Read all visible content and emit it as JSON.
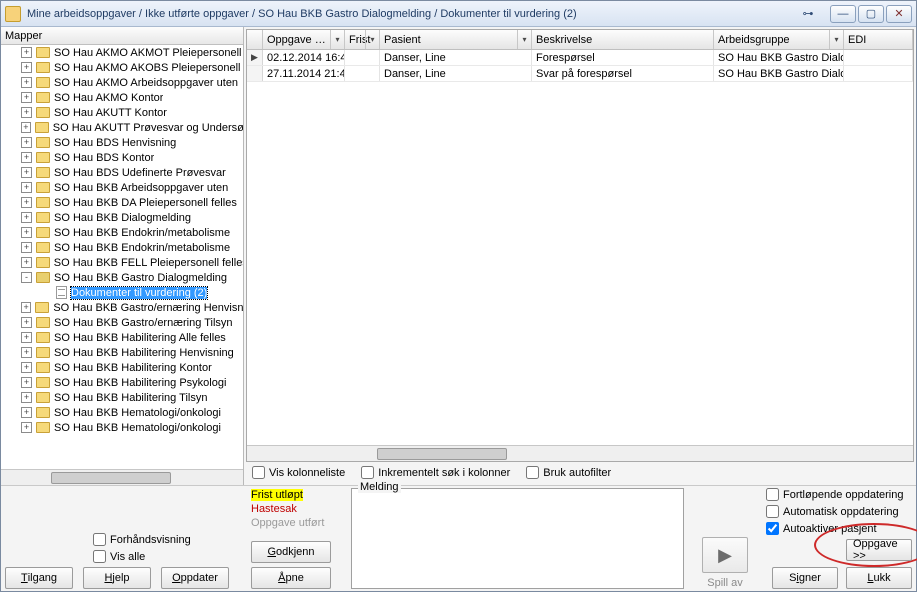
{
  "title": "Mine arbeidsoppgaver / Ikke utførte oppgaver / SO Hau BKB Gastro Dialogmelding / Dokumenter til vurdering (2)",
  "leftHeader": "Mapper",
  "tree": [
    {
      "l": "SO Hau AKMO AKMOT Pleiepersonell",
      "t": "+"
    },
    {
      "l": "SO Hau AKMO AKOBS Pleiepersonell",
      "t": "+"
    },
    {
      "l": "SO Hau AKMO Arbeidsoppgaver uten",
      "t": "+"
    },
    {
      "l": "SO Hau AKMO Kontor",
      "t": "+"
    },
    {
      "l": "SO Hau AKUTT Kontor",
      "t": "+"
    },
    {
      "l": "SO Hau AKUTT Prøvesvar og Undersøkelser",
      "t": "+"
    },
    {
      "l": "SO Hau BDS Henvisning",
      "t": "+"
    },
    {
      "l": "SO Hau BDS Kontor",
      "t": "+"
    },
    {
      "l": "SO Hau BDS Udefinerte Prøvesvar",
      "t": "+"
    },
    {
      "l": "SO Hau BKB Arbeidsoppgaver uten",
      "t": "+"
    },
    {
      "l": "SO Hau BKB DA Pleiepersonell felles",
      "t": "+"
    },
    {
      "l": "SO Hau BKB Dialogmelding",
      "t": "+"
    },
    {
      "l": "SO Hau BKB Endokrin/metabolisme",
      "t": "+"
    },
    {
      "l": "SO Hau BKB Endokrin/metabolisme",
      "t": "+"
    },
    {
      "l": "SO Hau BKB FELL Pleiepersonell felles",
      "t": "+"
    },
    {
      "l": "SO Hau BKB Gastro Dialogmelding",
      "t": "-",
      "open": true
    },
    {
      "l": "Dokumenter til vurdering (2)",
      "t": "",
      "doc": true,
      "sel": true,
      "indent": 1
    },
    {
      "l": "SO Hau BKB Gastro/ernæring Henvisning",
      "t": "+"
    },
    {
      "l": "SO Hau BKB Gastro/ernæring Tilsyn",
      "t": "+"
    },
    {
      "l": "SO Hau BKB Habilitering Alle felles",
      "t": "+"
    },
    {
      "l": "SO Hau BKB Habilitering Henvisning",
      "t": "+"
    },
    {
      "l": "SO Hau BKB Habilitering Kontor",
      "t": "+"
    },
    {
      "l": "SO Hau BKB Habilitering Psykologi",
      "t": "+"
    },
    {
      "l": "SO Hau BKB Habilitering Tilsyn",
      "t": "+"
    },
    {
      "l": "SO Hau BKB Hematologi/onkologi",
      "t": "+"
    },
    {
      "l": "SO Hau BKB Hematologi/onkologi",
      "t": "+"
    }
  ],
  "grid": {
    "cols": [
      "Oppgave …",
      "Frist",
      "Pasient",
      "Beskrivelse",
      "Arbeidsgruppe",
      "EDI"
    ],
    "rows": [
      {
        "opp": "02.12.2014 16:4",
        "frist": "",
        "pas": "Danser, Line",
        "besk": "Forespørsel",
        "arb": "SO Hau BKB Gastro Dialogm"
      },
      {
        "opp": "27.11.2014 21:4",
        "frist": "",
        "pas": "Danser, Line",
        "besk": "Svar på forespørsel",
        "arb": "SO Hau BKB Gastro Dialogm"
      }
    ]
  },
  "opts": {
    "a": "Vis kolonneliste",
    "b": "Inkrementelt søk i kolonner",
    "c": "Bruk autofilter"
  },
  "legend": {
    "a": "Frist utløpt",
    "b": "Hastesak",
    "c": "Oppgave utført"
  },
  "chk2": {
    "a": "Forhåndsvisning",
    "b": "Vis alle"
  },
  "msgLabel": "Melding",
  "play": "Spill av",
  "rchk": {
    "a": "Fortløpende oppdatering",
    "b": "Automatisk oppdatering",
    "c": "Autoaktiver pasjent"
  },
  "btns": {
    "tilgang": "Tilgang",
    "hjelp": "Hjelp",
    "oppdater": "Oppdater",
    "godkjenn": "Godkjenn",
    "apne": "Åpne",
    "oppgave": "Oppgave >>",
    "signer": "Signer",
    "lukk": "Lukk"
  }
}
